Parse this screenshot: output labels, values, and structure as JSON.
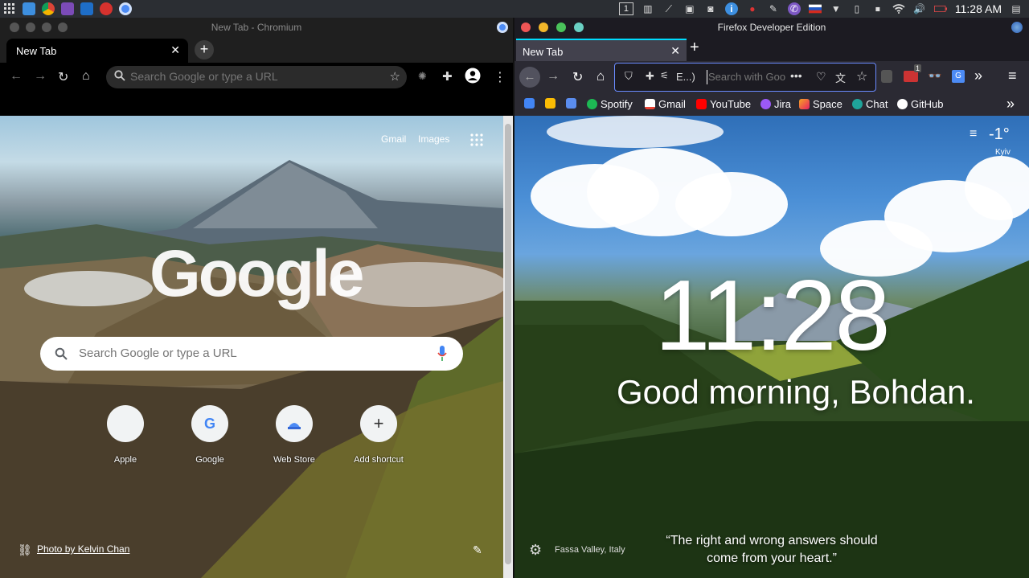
{
  "panel": {
    "workspace": "1",
    "clock": "11:28 AM"
  },
  "chromium": {
    "window_title": "New Tab - Chromium",
    "tab_label": "New Tab",
    "omnibox_placeholder": "Search Google or type a URL",
    "ntp": {
      "link_gmail": "Gmail",
      "link_images": "Images",
      "logo": "Google",
      "search_placeholder": "Search Google or type a URL",
      "shortcuts": [
        {
          "name": "Apple"
        },
        {
          "name": "Google"
        },
        {
          "name": "Web Store"
        },
        {
          "name": "Add shortcut"
        }
      ],
      "photo_credit": "Photo by Kelvin Chan"
    }
  },
  "firefox": {
    "window_title": "Firefox Developer Edition",
    "tab_label": "New Tab",
    "extension_label": "E...)",
    "url_placeholder": "Search with Goo",
    "badge_count": "1",
    "bookmarks": [
      "Spotify",
      "Gmail",
      "YouTube",
      "Jira",
      "Space",
      "Chat",
      "GitHub"
    ],
    "momentum": {
      "temperature": "-1°",
      "city": "Kyiv",
      "clock": "11:28",
      "greeting": "Good morning, Bohdan.",
      "location": "Fassa Valley, Italy",
      "quote_line1": "“The right and wrong answers should",
      "quote_line2": "come from your heart.”"
    }
  },
  "colors": {
    "chromium_bg": "#000000",
    "firefox_toolbar": "#2b2a33",
    "firefox_tab_accent": "#00ddff",
    "clock_text": "#ffffff"
  }
}
